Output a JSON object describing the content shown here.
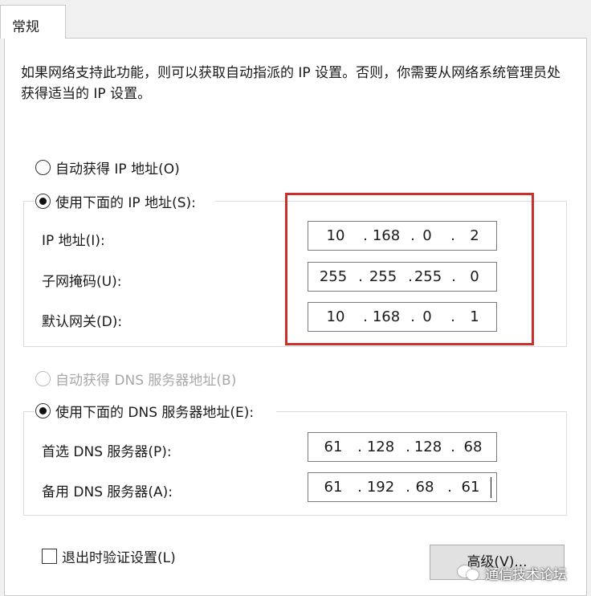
{
  "tab": {
    "label": "常规"
  },
  "description": "如果网络支持此功能，则可以获取自动指派的 IP 设置。否则，你需要从网络系统管理员处获得适当的 IP 设置。",
  "ip": {
    "auto_label": "自动获得 IP 地址(O)",
    "auto_selected": false,
    "manual_label": "使用下面的 IP 地址(S):",
    "manual_selected": true,
    "fields": [
      {
        "label": "IP 地址(I):",
        "octets": [
          "10",
          "168",
          "0",
          "2"
        ]
      },
      {
        "label": "子网掩码(U):",
        "octets": [
          "255",
          "255",
          "255",
          "0"
        ]
      },
      {
        "label": "默认网关(D):",
        "octets": [
          "10",
          "168",
          "0",
          "1"
        ]
      }
    ]
  },
  "dns": {
    "auto_label": "自动获得 DNS 服务器地址(B)",
    "auto_selected": false,
    "auto_disabled": true,
    "manual_label": "使用下面的 DNS 服务器地址(E):",
    "manual_selected": true,
    "fields": [
      {
        "label": "首选 DNS 服务器(P):",
        "octets": [
          "61",
          "128",
          "128",
          "68"
        ]
      },
      {
        "label": "备用 DNS 服务器(A):",
        "octets": [
          "61",
          "192",
          "68",
          "61"
        ]
      }
    ]
  },
  "validate": {
    "label": "退出时验证设置(L)",
    "checked": false
  },
  "advanced_button": "高级(V)...",
  "watermark": {
    "text": "通信技术论坛",
    "icon": "wechat-icon"
  },
  "colors": {
    "highlight_frame": "#c9302c",
    "panel_bg": "#ffffff",
    "window_bg": "#f0f0f0"
  }
}
